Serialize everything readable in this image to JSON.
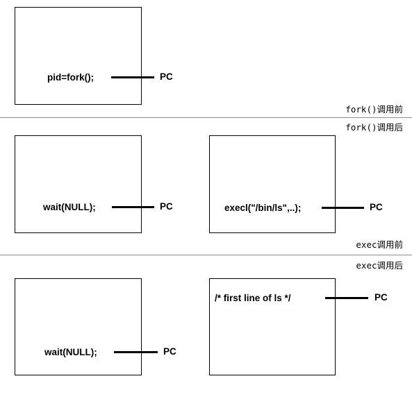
{
  "panels": [
    {
      "code": "pid=fork();",
      "pointer": "PC"
    },
    {
      "code": "wait(NULL);",
      "pointer": "PC"
    },
    {
      "code": "execl(\"/bin/ls\",..);",
      "pointer": "PC"
    },
    {
      "code": "wait(NULL);",
      "pointer": "PC"
    },
    {
      "code": "/* first line of ls */",
      "pointer": "PC"
    }
  ],
  "captions": {
    "fork_before": "fork()调用前",
    "fork_after": "fork()调用后",
    "exec_before": "exec调用前",
    "exec_after": "exec调用后"
  }
}
